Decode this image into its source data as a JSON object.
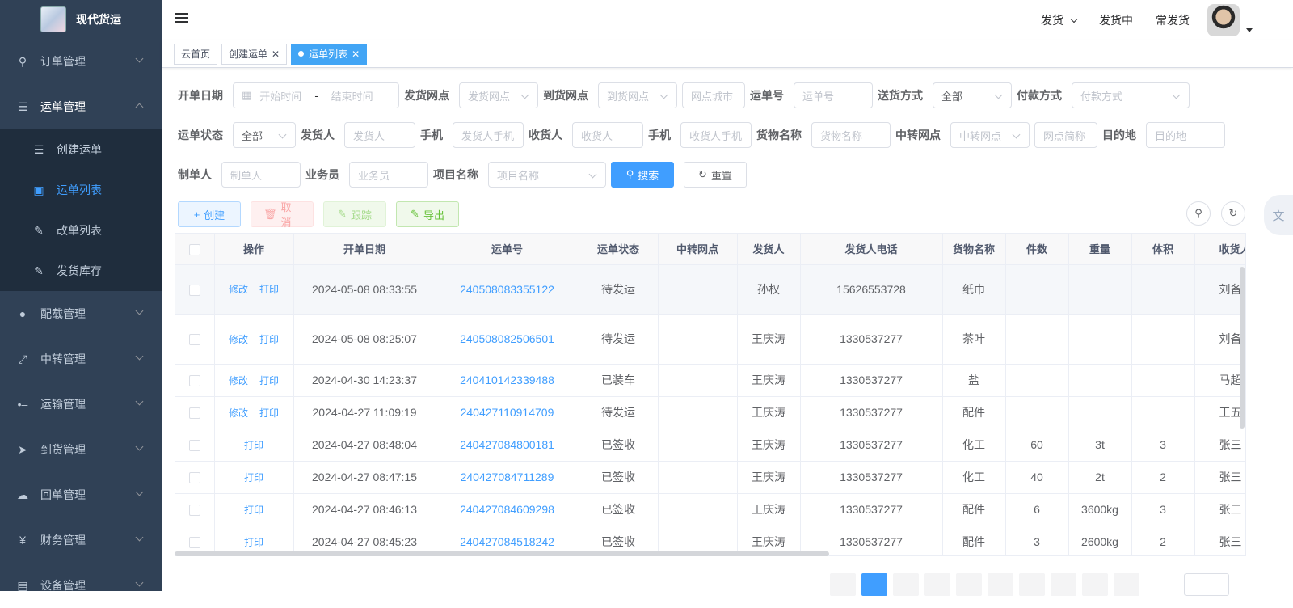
{
  "app": {
    "title": "现代货运"
  },
  "sidebar": {
    "items": [
      {
        "label": "订单管理",
        "icon": "search-icon"
      },
      {
        "label": "运单管理",
        "icon": "list-icon"
      },
      {
        "label": "配载管理",
        "icon": "globe-icon"
      },
      {
        "label": "中转管理",
        "icon": "fullscreen-icon"
      },
      {
        "label": "运输管理",
        "icon": "route-icon"
      },
      {
        "label": "到货管理",
        "icon": "send-icon"
      },
      {
        "label": "回单管理",
        "icon": "upload-cloud-icon"
      },
      {
        "label": "财务管理",
        "icon": "yen-icon"
      },
      {
        "label": "设备管理",
        "icon": "device-icon"
      }
    ],
    "sub_items": [
      {
        "label": "创建运单",
        "icon": "list-icon"
      },
      {
        "label": "运单列表",
        "icon": "document-icon"
      },
      {
        "label": "改单列表",
        "icon": "edit-icon"
      },
      {
        "label": "发货库存",
        "icon": "edit-icon"
      }
    ]
  },
  "navbar": {
    "ship_menu": "发货",
    "shipping": "发货中",
    "frequent": "常发货"
  },
  "tags": [
    {
      "label": "云首页"
    },
    {
      "label": "创建运单"
    },
    {
      "label": "运单列表"
    }
  ],
  "filters": {
    "open_date": "开单日期",
    "start_time": "开始时间",
    "date_sep": "-",
    "end_time": "结束时间",
    "ship_point": "发货网点",
    "ship_point_ph": "发货网点",
    "arrive_point": "到货网点",
    "arrive_point_ph": "到货网点",
    "point_city_ph": "网点城市",
    "waybill_no": "运单号",
    "waybill_no_ph": "运单号",
    "delivery": "送货方式",
    "delivery_val": "全部",
    "payment": "付款方式",
    "payment_ph": "付款方式",
    "status": "运单状态",
    "status_val": "全部",
    "shipper": "发货人",
    "shipper_ph": "发货人",
    "phone": "手机",
    "shipper_phone_ph": "发货人手机",
    "receiver": "收货人",
    "receiver_ph": "收货人",
    "phone2": "手机",
    "receiver_phone_ph": "收货人手机",
    "goods": "货物名称",
    "goods_ph": "货物名称",
    "transfer": "中转网点",
    "transfer_ph": "中转网点",
    "point_abbr_ph": "网点简称",
    "dest": "目的地",
    "dest_ph": "目的地",
    "maker": "制单人",
    "maker_ph": "制单人",
    "salesman": "业务员",
    "salesman_ph": "业务员",
    "project": "项目名称",
    "project_ph": "项目名称",
    "search_btn": "搜索",
    "reset_btn": "重置"
  },
  "toolbar": {
    "create": "创建",
    "cancel": "取消",
    "track": "跟踪",
    "export": "导出"
  },
  "table": {
    "headers": [
      "操作",
      "开单日期",
      "运单号",
      "运单状态",
      "中转网点",
      "发货人",
      "发货人电话",
      "货物名称",
      "件数",
      "重量",
      "体积",
      "收货人"
    ],
    "edit_label": "修改",
    "print_label": "打印",
    "rows": [
      {
        "edit": true,
        "date": "2024-05-08 08:33:55",
        "no": "240508083355122",
        "status": "待发运",
        "transfer": "",
        "shipper": "孙权",
        "phone": "15626553728",
        "goods": "纸巾",
        "count": "",
        "weight": "",
        "volume": "",
        "receiver": "刘备"
      },
      {
        "edit": true,
        "date": "2024-05-08 08:25:07",
        "no": "240508082506501",
        "status": "待发运",
        "transfer": "",
        "shipper": "王庆涛",
        "phone": "1330537277",
        "goods": "茶叶",
        "count": "",
        "weight": "",
        "volume": "",
        "receiver": "刘备"
      },
      {
        "edit": true,
        "date": "2024-04-30 14:23:37",
        "no": "240410142339488",
        "status": "已装车",
        "transfer": "",
        "shipper": "王庆涛",
        "phone": "1330537277",
        "goods": "盐",
        "count": "",
        "weight": "",
        "volume": "",
        "receiver": "马超"
      },
      {
        "edit": true,
        "date": "2024-04-27 11:09:19",
        "no": "240427110914709",
        "status": "待发运",
        "transfer": "",
        "shipper": "王庆涛",
        "phone": "1330537277",
        "goods": "配件",
        "count": "",
        "weight": "",
        "volume": "",
        "receiver": "王五"
      },
      {
        "edit": false,
        "date": "2024-04-27 08:48:04",
        "no": "240427084800181",
        "status": "已签收",
        "transfer": "",
        "shipper": "王庆涛",
        "phone": "1330537277",
        "goods": "化工",
        "count": "60",
        "weight": "3t",
        "volume": "3",
        "receiver": "张三"
      },
      {
        "edit": false,
        "date": "2024-04-27 08:47:15",
        "no": "240427084711289",
        "status": "已签收",
        "transfer": "",
        "shipper": "王庆涛",
        "phone": "1330537277",
        "goods": "化工",
        "count": "40",
        "weight": "2t",
        "volume": "2",
        "receiver": "张三"
      },
      {
        "edit": false,
        "date": "2024-04-27 08:46:13",
        "no": "240427084609298",
        "status": "已签收",
        "transfer": "",
        "shipper": "王庆涛",
        "phone": "1330537277",
        "goods": "配件",
        "count": "6",
        "weight": "3600kg",
        "volume": "3",
        "receiver": "张三"
      },
      {
        "edit": false,
        "date": "2024-04-27 08:45:23",
        "no": "240427084518242",
        "status": "已签收",
        "transfer": "",
        "shipper": "王庆涛",
        "phone": "1330537277",
        "goods": "配件",
        "count": "3",
        "weight": "2600kg",
        "volume": "2",
        "receiver": "张三"
      }
    ]
  },
  "pagination": {
    "current": 1
  }
}
